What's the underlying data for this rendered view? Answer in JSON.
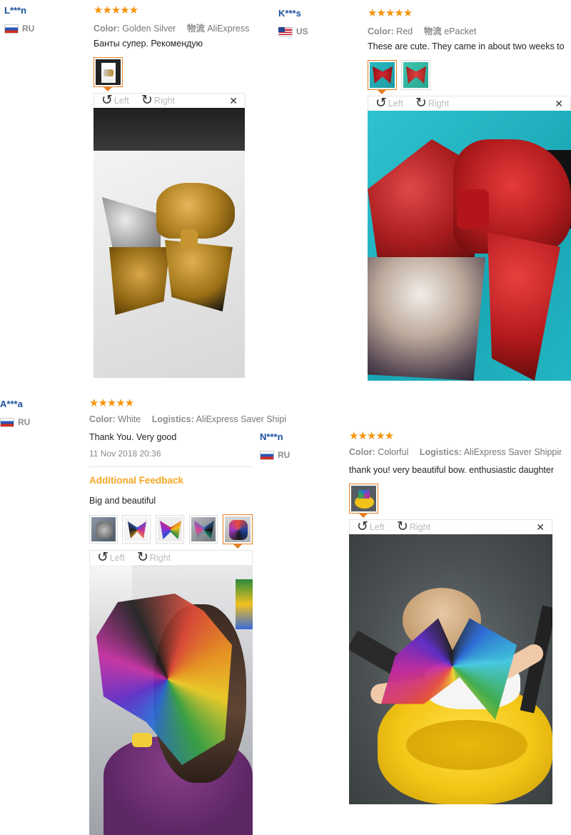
{
  "reviews": [
    {
      "user": "L***n",
      "country": "RU",
      "stars": "★★★★★",
      "color_label": "Color:",
      "color": "Golden Silver",
      "logistics_label": "物流",
      "logistics": "AliExpress",
      "text": "Банты супер. Рекомендую",
      "viewer": {
        "left": "Left",
        "right": "Right",
        "close": "✕"
      }
    },
    {
      "user": "K***s",
      "country": "US",
      "stars": "★★★★★",
      "color_label": "Color:",
      "color": "Red",
      "logistics_label": "物流",
      "logistics": "ePacket",
      "text": "These are cute. They came in about two weeks to",
      "viewer": {
        "left": "Left",
        "right": "Right",
        "close": "✕"
      }
    },
    {
      "user": "A***a",
      "country": "RU",
      "stars": "★★★★★",
      "color_label": "Color:",
      "color": "White",
      "logistics_label": "Logistics:",
      "logistics": "AliExpress Saver Shipi",
      "text": "Thank You. Very good",
      "date": "11 Nov 2018 20:36",
      "additional_title": "Additional Feedback",
      "additional_text": "Big and beautiful",
      "viewer": {
        "left": "Left",
        "right": "Right",
        "close": "✕"
      }
    },
    {
      "user": "N***n",
      "country": "RU",
      "stars": "★★★★★",
      "color_label": "Color:",
      "color": "Colorful",
      "logistics_label": "Logistics:",
      "logistics": "AliExpress Saver Shippir",
      "text": "thank you! very beautiful bow. enthusiastic daughter",
      "viewer": {
        "left": "Left",
        "right": "Right",
        "close": "✕"
      }
    }
  ],
  "icons": {
    "rotate_left": "rotate-left-icon",
    "rotate_right": "rotate-right-icon",
    "close": "close-icon",
    "star": "star-icon",
    "flag": "flag-icon"
  },
  "colors": {
    "user": "#1a4f9c",
    "star": "#f5930a",
    "additional": "#f5a623",
    "selected_border": "#e67e22"
  }
}
